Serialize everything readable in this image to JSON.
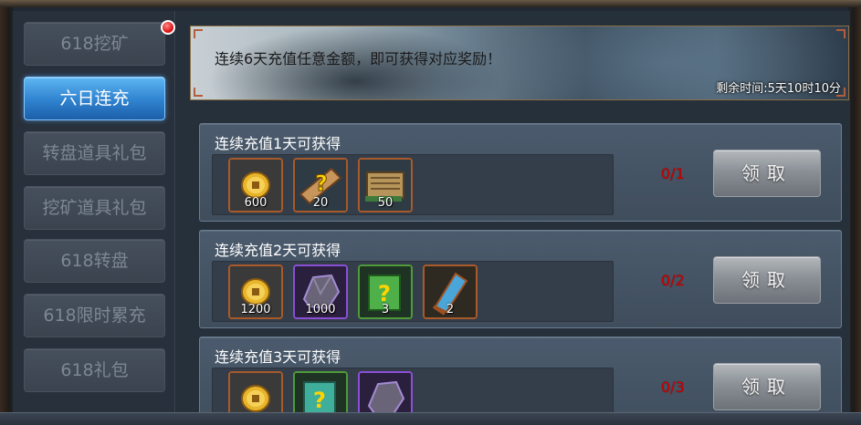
{
  "sidebar": {
    "items": [
      {
        "label": "618挖矿",
        "active": false,
        "badge": true
      },
      {
        "label": "六日连充",
        "active": true,
        "badge": false
      },
      {
        "label": "转盘道具礼包",
        "active": false,
        "badge": false
      },
      {
        "label": "挖矿道具礼包",
        "active": false,
        "badge": false
      },
      {
        "label": "618转盘",
        "active": false,
        "badge": false
      },
      {
        "label": "618限时累充",
        "active": false,
        "badge": false
      },
      {
        "label": "618礼包",
        "active": false,
        "badge": false
      }
    ]
  },
  "banner": {
    "text": "连续6天充值任意金额，即可获得对应奖励！",
    "time": "剩余时间:5天10时10分"
  },
  "rows": [
    {
      "title": "连续充值1天可获得",
      "progress": "0/1",
      "claim_label": "领取",
      "items": [
        {
          "icon": "gold-coin-icon",
          "count": "600"
        },
        {
          "icon": "mystery-scroll-icon",
          "count": "20"
        },
        {
          "icon": "book-scroll-icon",
          "count": "50"
        }
      ]
    },
    {
      "title": "连续充值2天可获得",
      "progress": "0/2",
      "claim_label": "领取",
      "items": [
        {
          "icon": "gold-coin-icon",
          "count": "1200"
        },
        {
          "icon": "ore-stone-icon",
          "count": "1000"
        },
        {
          "icon": "mystery-book-icon",
          "count": "3"
        },
        {
          "icon": "blue-scroll-icon",
          "count": "2"
        }
      ]
    },
    {
      "title": "连续充值3天可获得",
      "progress": "0/3",
      "claim_label": "领取",
      "items": [
        {
          "icon": "gold-coin-icon",
          "count": ""
        },
        {
          "icon": "mystery-book-icon",
          "count": ""
        },
        {
          "icon": "ore-stone-icon",
          "count": ""
        }
      ]
    }
  ]
}
